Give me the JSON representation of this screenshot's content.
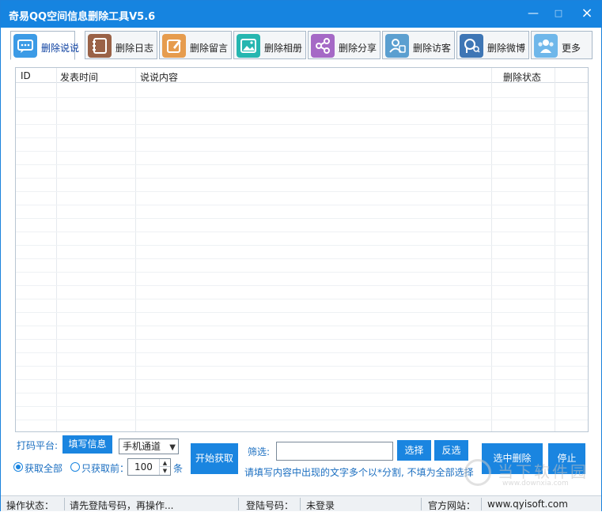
{
  "window": {
    "title": "奇易QQ空间信息删除工具V5.6",
    "min_glyph": "—",
    "max_glyph": "□",
    "close_glyph": "×"
  },
  "tabs": [
    {
      "label": "删除说说",
      "icon": "chat-bubble-icon",
      "color": "#3c9be6",
      "active": true
    },
    {
      "label": "删除日志",
      "icon": "notebook-icon",
      "color": "#9a6247",
      "active": false
    },
    {
      "label": "删除留言",
      "icon": "edit-note-icon",
      "color": "#e69c4e",
      "active": false
    },
    {
      "label": "删除相册",
      "icon": "photo-icon",
      "color": "#25b6b0",
      "active": false
    },
    {
      "label": "删除分享",
      "icon": "share-icon",
      "color": "#a569c6",
      "active": false
    },
    {
      "label": "删除访客",
      "icon": "visitor-icon",
      "color": "#5b9fd0",
      "active": false
    },
    {
      "label": "删除微博",
      "icon": "weibo-search-icon",
      "color": "#3e76b5",
      "active": false
    },
    {
      "label": "更多",
      "icon": "users-icon",
      "color": "#6fb7ea",
      "active": false
    }
  ],
  "table": {
    "columns": [
      "ID",
      "发表时间",
      "说说内容",
      "删除状态"
    ],
    "rows": []
  },
  "controls": {
    "captcha_label": "打码平台:",
    "fill_info_button": "填写信息",
    "channel_select": "手机通道",
    "get_all_label": "获取全部",
    "get_only_label": "只获取前：",
    "count_value": "100",
    "count_unit": "条",
    "start_button": "开始获取",
    "filter_label": "筛选:",
    "filter_value": "",
    "select_button": "选择",
    "invert_button": "反选",
    "filter_hint": "请填写内容中出现的文字多个以*分割, 不填为全部选择",
    "delete_selected_button": "选中删除",
    "stop_button": "停止"
  },
  "watermark": {
    "text": "当下软件园",
    "url": "www.downxia.com"
  },
  "status": {
    "op_label": "操作状态：",
    "op_value": "请先登陆号码，再操作...",
    "login_label": "登陆号码：",
    "login_value": "未登录",
    "site_label": "官方网站：",
    "site_value": "www.qyisoft.com"
  },
  "colors": {
    "accent": "#1a85e0",
    "titlebar": "#1684e0"
  }
}
